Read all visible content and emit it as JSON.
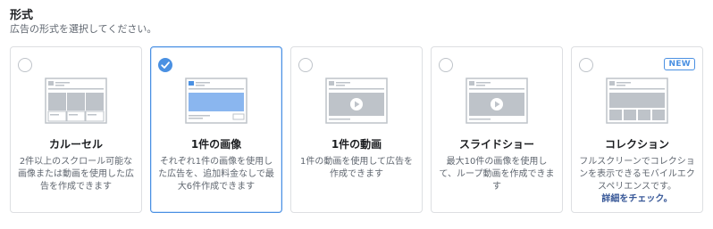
{
  "section": {
    "title": "形式",
    "subtitle": "広告の形式を選択してください。"
  },
  "formats": [
    {
      "name": "カルーセル",
      "description": "2件以上のスクロール可能な画像または動画を使用した広告を作成できます",
      "selected": false
    },
    {
      "name": "1件の画像",
      "description": "それぞれ1件の画像を使用した広告を、追加料金なしで最大6件作成できます",
      "selected": true
    },
    {
      "name": "1件の動画",
      "description": "1件の動画を使用して広告を作成できます",
      "selected": false
    },
    {
      "name": "スライドショー",
      "description": "最大10件の画像を使用して、ループ動画を作成できます",
      "selected": false
    },
    {
      "name": "コレクション",
      "description": "フルスクリーンでコレクションを表示できるモバイルエクスペリエンスです。",
      "selected": false,
      "badge": "NEW",
      "link": "詳細をチェック。"
    }
  ],
  "colors": {
    "accent": "#4a90e2",
    "thumb_gray": "#bec3c9",
    "link": "#385898"
  },
  "icons": [
    "checkmark-icon",
    "play-icon"
  ]
}
